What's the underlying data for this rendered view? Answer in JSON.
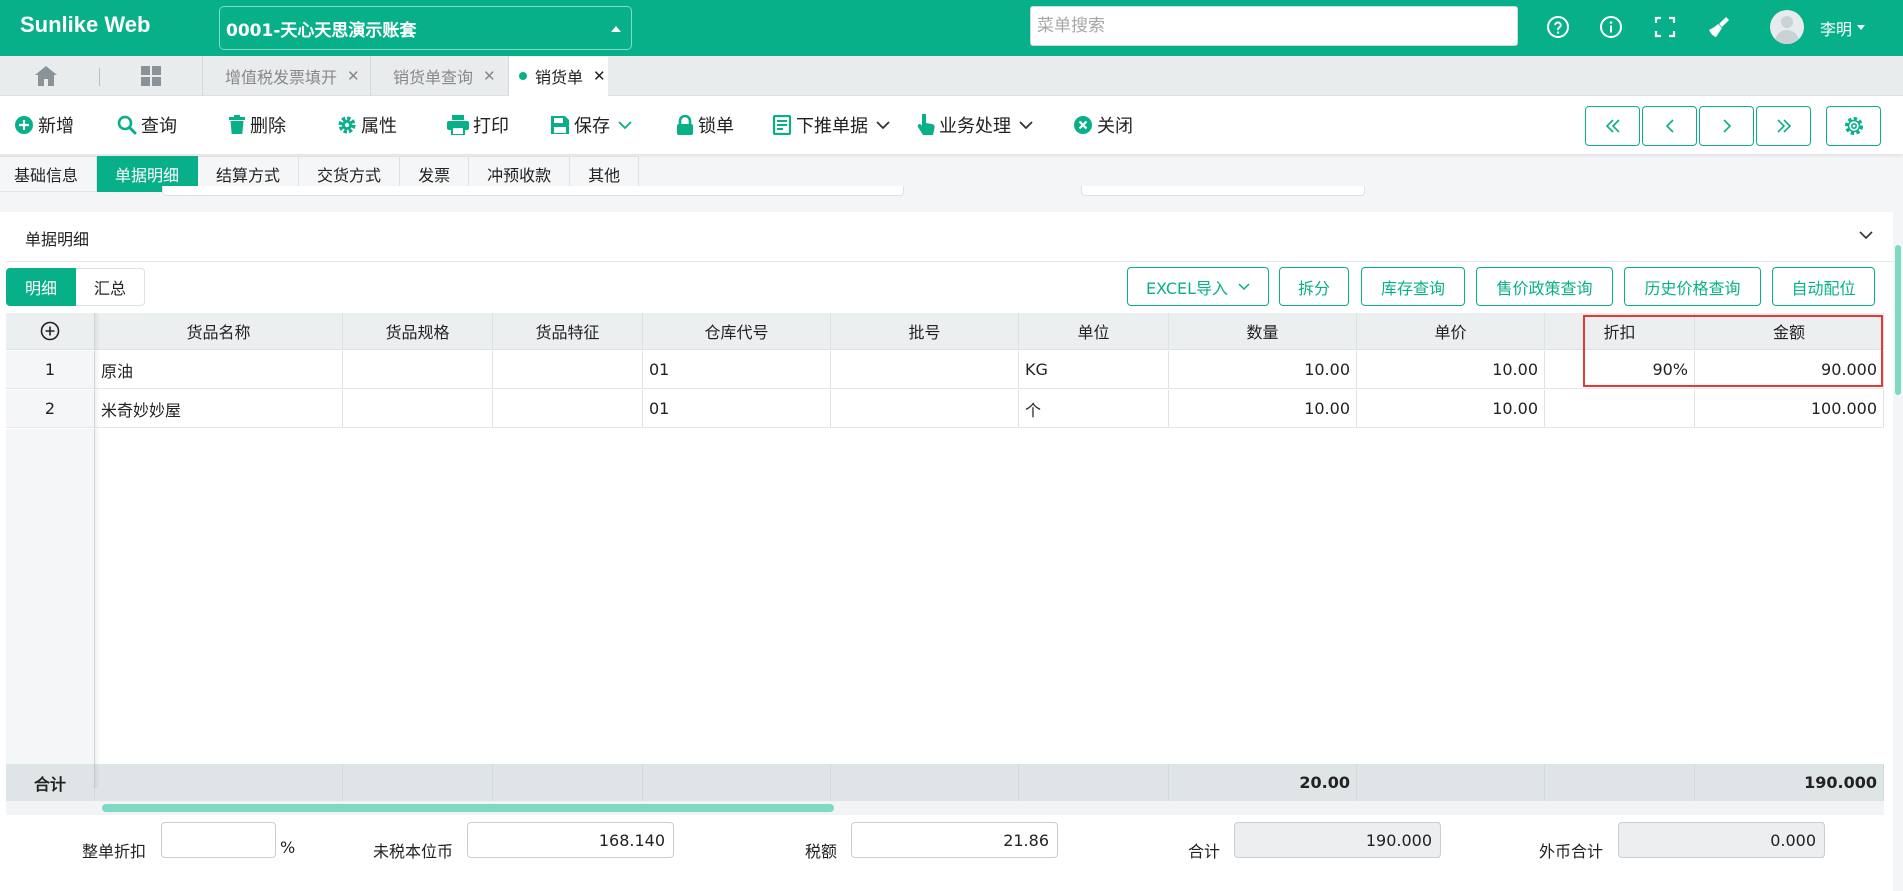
{
  "header": {
    "brand": "Sunlike Web",
    "account": "0001-天心天思演示账套",
    "search_placeholder": "菜单搜索",
    "username": "李明"
  },
  "tabs": [
    {
      "label": "增值税发票填开"
    },
    {
      "label": "销货单查询"
    },
    {
      "label": "销货单"
    }
  ],
  "toolbar": {
    "new": "新增",
    "query": "查询",
    "delete": "删除",
    "properties": "属性",
    "print": "打印",
    "save": "保存",
    "lock": "锁单",
    "push_down": "下推单据",
    "business": "业务处理",
    "close": "关闭"
  },
  "section_tabs": [
    "基础信息",
    "单据明细",
    "结算方式",
    "交货方式",
    "发票",
    "冲预收款",
    "其他"
  ],
  "panel": {
    "title": "单据明细",
    "view_detail": "明细",
    "view_summary": "汇总",
    "actions": [
      "EXCEL导入",
      "拆分",
      "库存查询",
      "售价政策查询",
      "历史价格查询",
      "自动配位"
    ]
  },
  "grid": {
    "columns": [
      "货品名称",
      "货品规格",
      "货品特征",
      "仓库代号",
      "批号",
      "单位",
      "数量",
      "单价",
      "折扣",
      "金额"
    ],
    "rows": [
      {
        "no": "1",
        "name": "原油",
        "spec": "",
        "feature": "",
        "warehouse": "01",
        "batch": "",
        "unit": "KG",
        "qty": "10.00",
        "price": "10.00",
        "discount": "90%",
        "amount": "90.000"
      },
      {
        "no": "2",
        "name": "米奇妙妙屋",
        "spec": "",
        "feature": "",
        "warehouse": "01",
        "batch": "",
        "unit": "个",
        "qty": "10.00",
        "price": "10.00",
        "discount": "",
        "amount": "100.000"
      }
    ],
    "sum": {
      "label": "合计",
      "qty": "20.00",
      "amount": "190.000"
    }
  },
  "footer": {
    "order_discount_label": "整单折扣",
    "order_discount_value": "",
    "percent": "%",
    "pretax_label": "未税本位币",
    "pretax_value": "168.140",
    "tax_label": "税额",
    "tax_value": "21.86",
    "total_label": "合计",
    "total_value": "190.000",
    "fx_total_label": "外币合计",
    "fx_total_value": "0.000"
  },
  "colors": {
    "accent": "#08b08a",
    "highlight": "#e53935"
  }
}
